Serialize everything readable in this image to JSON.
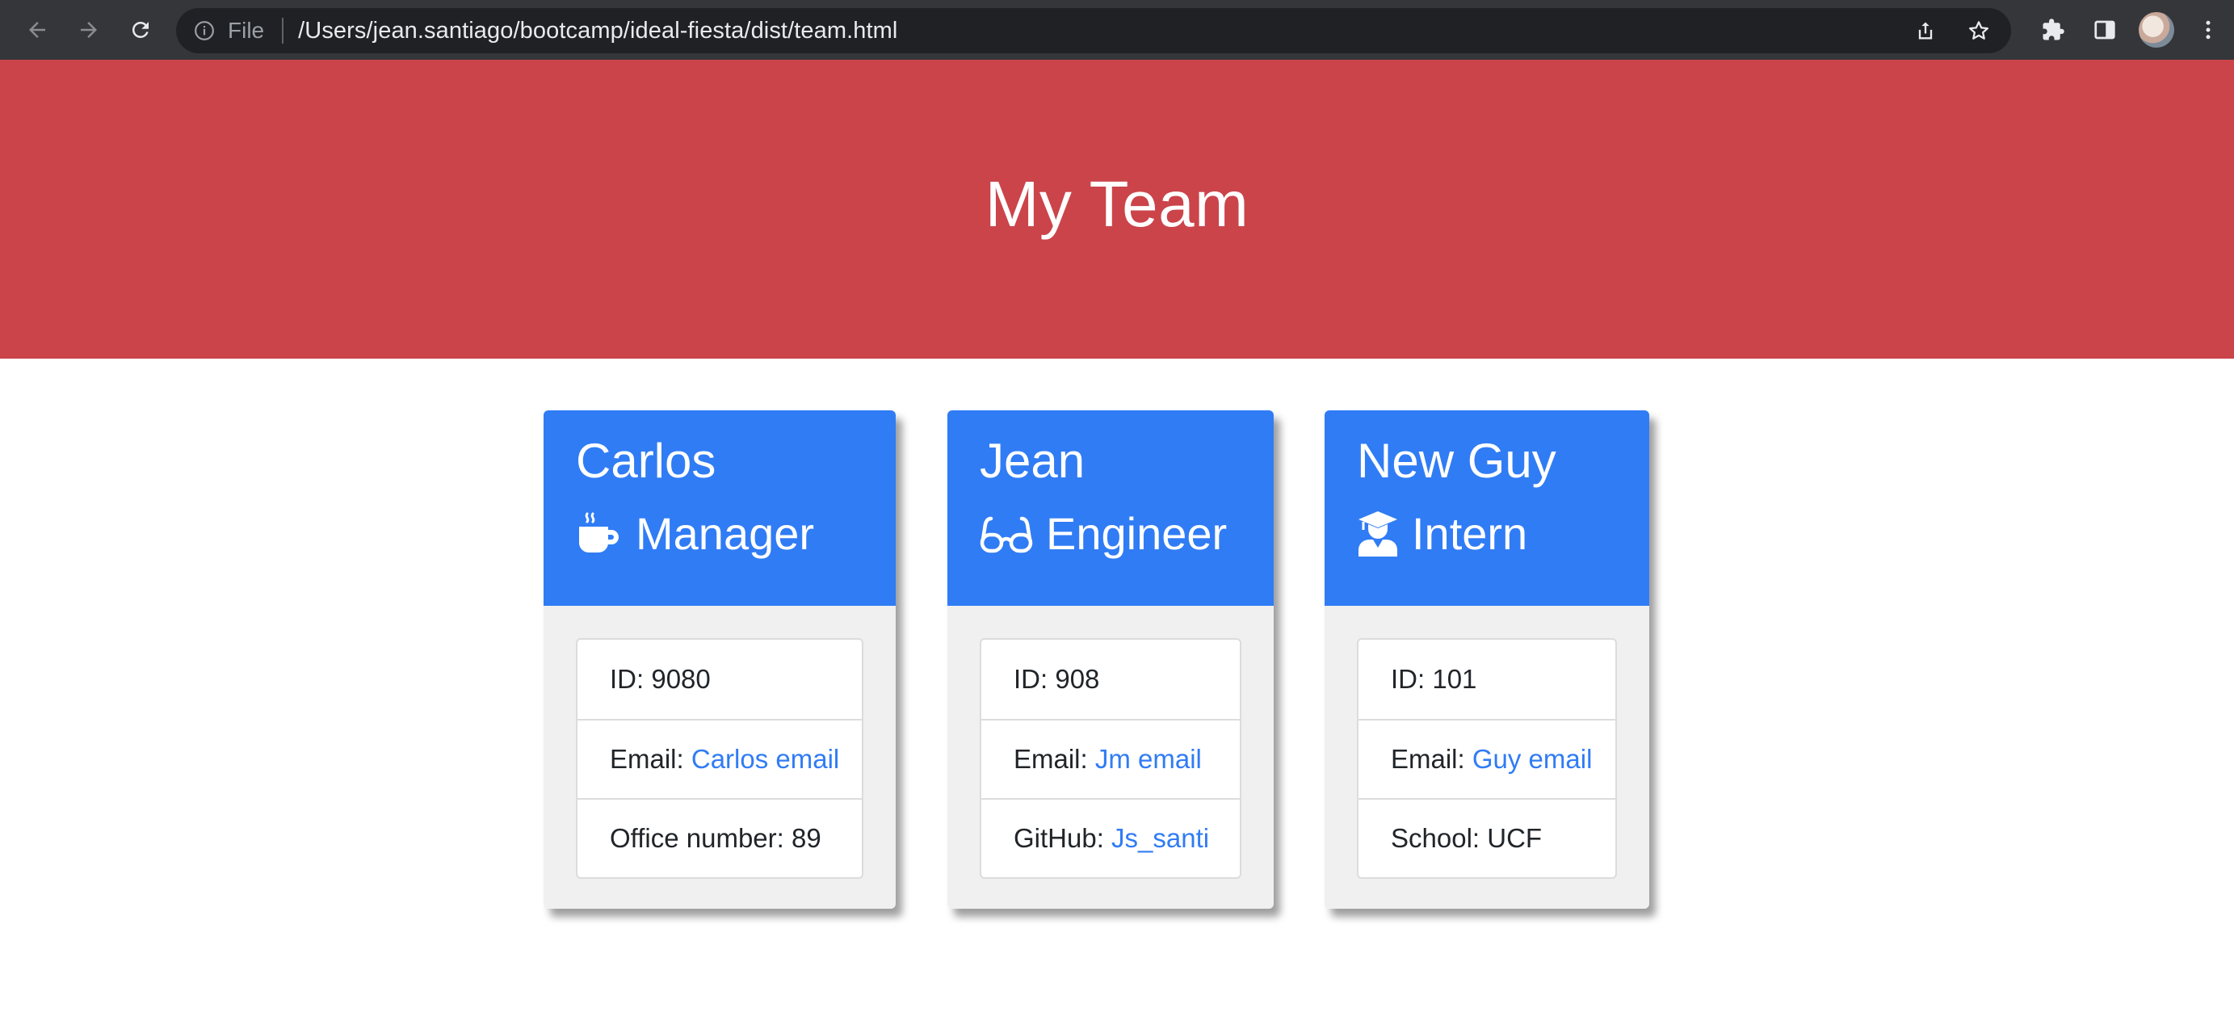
{
  "browser": {
    "file_label": "File",
    "url": "/Users/jean.santiago/bootcamp/ideal-fiesta/dist/team.html"
  },
  "header": {
    "title": "My Team"
  },
  "team": [
    {
      "name": "Carlos",
      "role": "Manager",
      "icon": "coffee-icon",
      "id_text": "ID: 9080",
      "email_prefix": "Email: ",
      "email_link": "Carlos email",
      "extra_prefix": "Office number: 89",
      "extra_link": ""
    },
    {
      "name": "Jean",
      "role": "Engineer",
      "icon": "glasses-icon",
      "id_text": "ID: 908",
      "email_prefix": "Email: ",
      "email_link": "Jm email",
      "extra_prefix": "GitHub: ",
      "extra_link": "Js_santi"
    },
    {
      "name": "New Guy",
      "role": "Intern",
      "icon": "graduate-icon",
      "id_text": "ID: 101",
      "email_prefix": "Email: ",
      "email_link": "Guy email",
      "extra_prefix": "School: UCF",
      "extra_link": ""
    }
  ],
  "colors": {
    "jumbotron": "#cb444a",
    "card_header": "#307cf5",
    "link": "#307cf5"
  }
}
